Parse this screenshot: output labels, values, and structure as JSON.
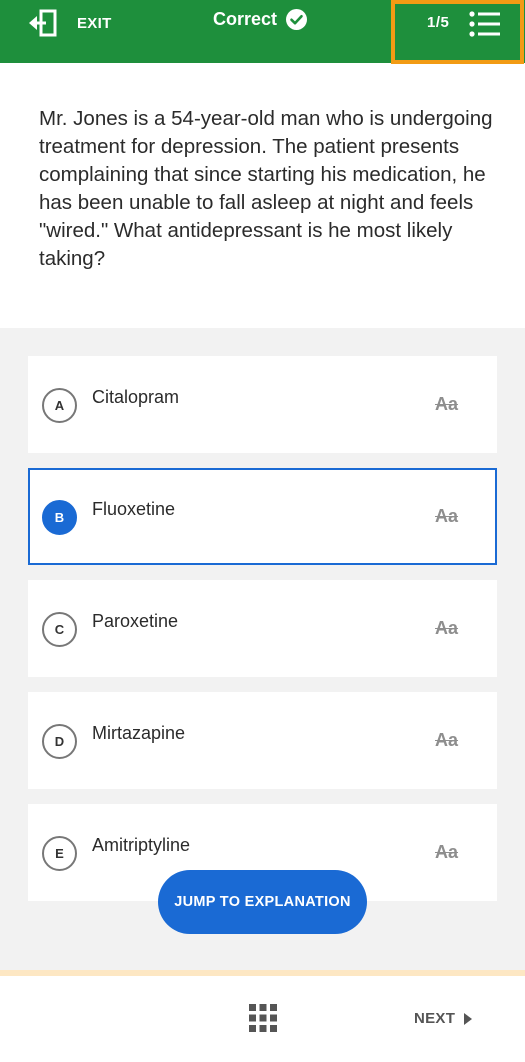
{
  "header": {
    "exit_label": "EXIT",
    "status_label": "Correct",
    "counter": "1/5",
    "background_color": "#1e8f3c",
    "highlight_color": "#f29b14",
    "exit_icon": "exit-icon",
    "status_icon": "check-circle-icon",
    "list_icon": "list-icon"
  },
  "question": {
    "text": "Mr. Jones is a 54-year-old man who is undergoing treatment for depression. The patient presents complaining that since starting his medication, he has been unable to fall asleep at night and feels \"wired.\" What antidepressant is he most likely taking?"
  },
  "choices": [
    {
      "letter": "A",
      "text": "Citalopram",
      "strike_label": "Aa",
      "selected": false
    },
    {
      "letter": "B",
      "text": "Fluoxetine",
      "strike_label": "Aa",
      "selected": true
    },
    {
      "letter": "C",
      "text": "Paroxetine",
      "strike_label": "Aa",
      "selected": false
    },
    {
      "letter": "D",
      "text": "Mirtazapine",
      "strike_label": "Aa",
      "selected": false
    },
    {
      "letter": "E",
      "text": "Amitriptyline",
      "strike_label": "Aa",
      "selected": false
    }
  ],
  "jump_button": {
    "label": "JUMP TO EXPLANATION"
  },
  "footer": {
    "next_label": "NEXT",
    "grid_icon": "grid-icon",
    "next_icon": "caret-right-icon"
  },
  "accent_color": "#1a6ad4"
}
